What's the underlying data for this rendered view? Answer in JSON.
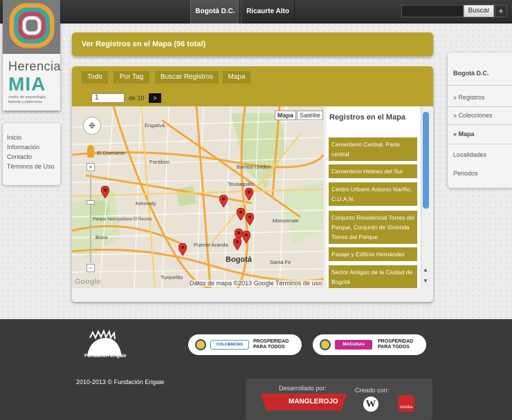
{
  "nav": {
    "tab_active": "Bogotá D.C.",
    "tab_2": "Ricaurte Alto",
    "search_placeholder": "",
    "search_button": "Buscar",
    "plus_button": "+"
  },
  "logo": {
    "word1": "Herencia",
    "word2": "MIA",
    "sub": "centro de arqueología, historia y patrimonio"
  },
  "leftmenu": [
    "Inicio",
    "Información",
    "Contacto",
    "Términos de Uso"
  ],
  "title": "Ver Registros en el Mapa (96 total)",
  "toolbar": [
    "Todo",
    "Por Tag",
    "Buscar Registros",
    "Mapa"
  ],
  "pagination": {
    "current": "1",
    "label": "de 10",
    "next": ">"
  },
  "map": {
    "toggle_map": "Mapa",
    "toggle_sat": "Satélite",
    "credit": "Datos de mapa ©2013 Google   Términos de uso",
    "google": "Google",
    "city_label": "Bogotá",
    "places": [
      "Fontibón",
      "Engativá",
      "Kennedy",
      "Barrios Unidos",
      "Teusaquillo",
      "Puente Aranda",
      "Tunjuelito",
      "Santa Fe",
      "Bosa",
      "Parque Metropolitano El Recreo",
      "El Diamante",
      "Monserrate"
    ]
  },
  "registros": {
    "title": "Registros en el Mapa",
    "items": [
      "Cementerio Central. Parte central",
      "Cementerio Hebreo del Sur",
      "Centro Urbano Antonio Nariño, C.U.A.N.",
      "Conjunto Residencial Torres del Parque, Conjunto de Vivienda Torres del Parque",
      "Pasaje y Edificio Hernández",
      "Sector Antiguo de la Ciudad de Bogotá"
    ]
  },
  "rightmenu": {
    "heading": "Bogotá D.C.",
    "items": [
      "» Registros",
      "» Colecciones",
      "» Mapa",
      "Localidades",
      "Periodos"
    ]
  },
  "footer": {
    "fundacion": "Fundación Erigaie",
    "colciencias": "COLCIENCIAS",
    "prosperidad1": "PROSPERIDAD PARA TODOS",
    "mincultura": "MinCultura",
    "prosperidad2": "PROSPERIDAD PARA TODOS",
    "copyright": "2010-2013 © Fundación Erigaie",
    "desarrollado": "Desarrollado por:",
    "creado": "Creado con:",
    "mangle": "MANGLEROJO",
    "omeka": "omeka"
  },
  "colors": {
    "gold": "#b8a22c",
    "gold_dark": "#a08e20",
    "marker": "#d9342b",
    "footer": "#3a3a3a"
  }
}
